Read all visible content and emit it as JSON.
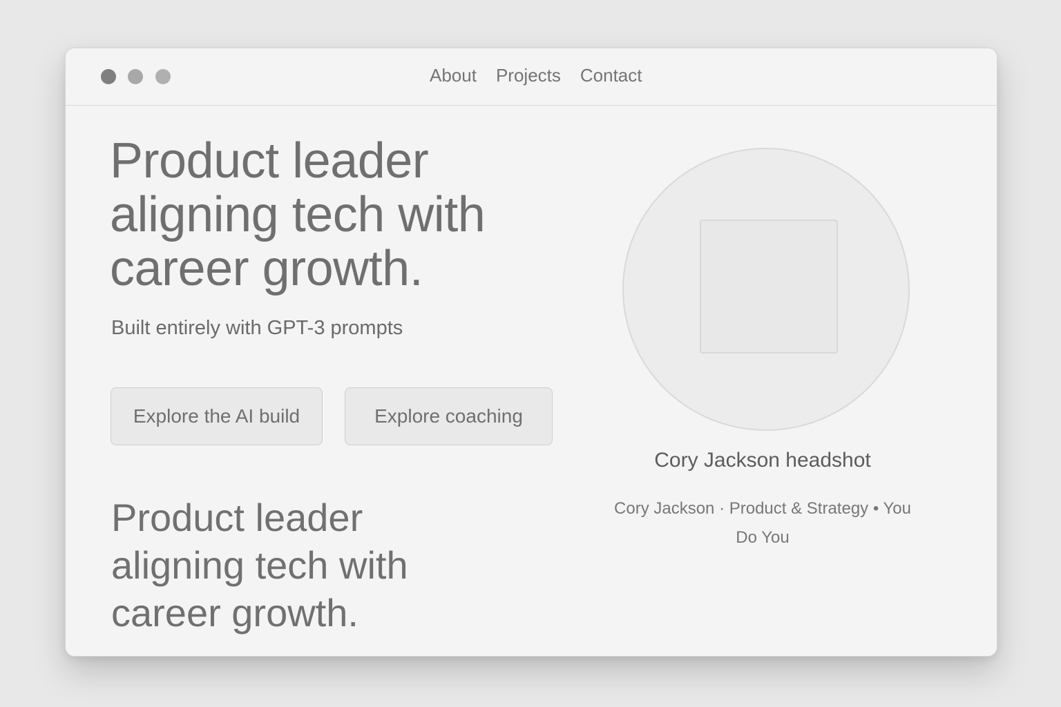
{
  "nav": {
    "items": [
      {
        "label": "About"
      },
      {
        "label": "Projects"
      },
      {
        "label": "Contact"
      }
    ]
  },
  "hero": {
    "title": "Product leader aligning tech with career growth.",
    "subtitle": "Built entirely with GPT-3 prompts",
    "buttons": {
      "ai_build": "Explore the AI build",
      "coaching": "Explore coaching"
    },
    "title_repeat": "Product leader aligning tech  with career growth."
  },
  "profile": {
    "image_caption": "Cory Jackson headshot",
    "byline_line1": "Cory Jackson · Product & Strategy  •  You",
    "byline_line2": "Do You"
  },
  "colors": {
    "background": "#e8e8e8",
    "window": "#f4f4f4",
    "text": "#707070"
  }
}
